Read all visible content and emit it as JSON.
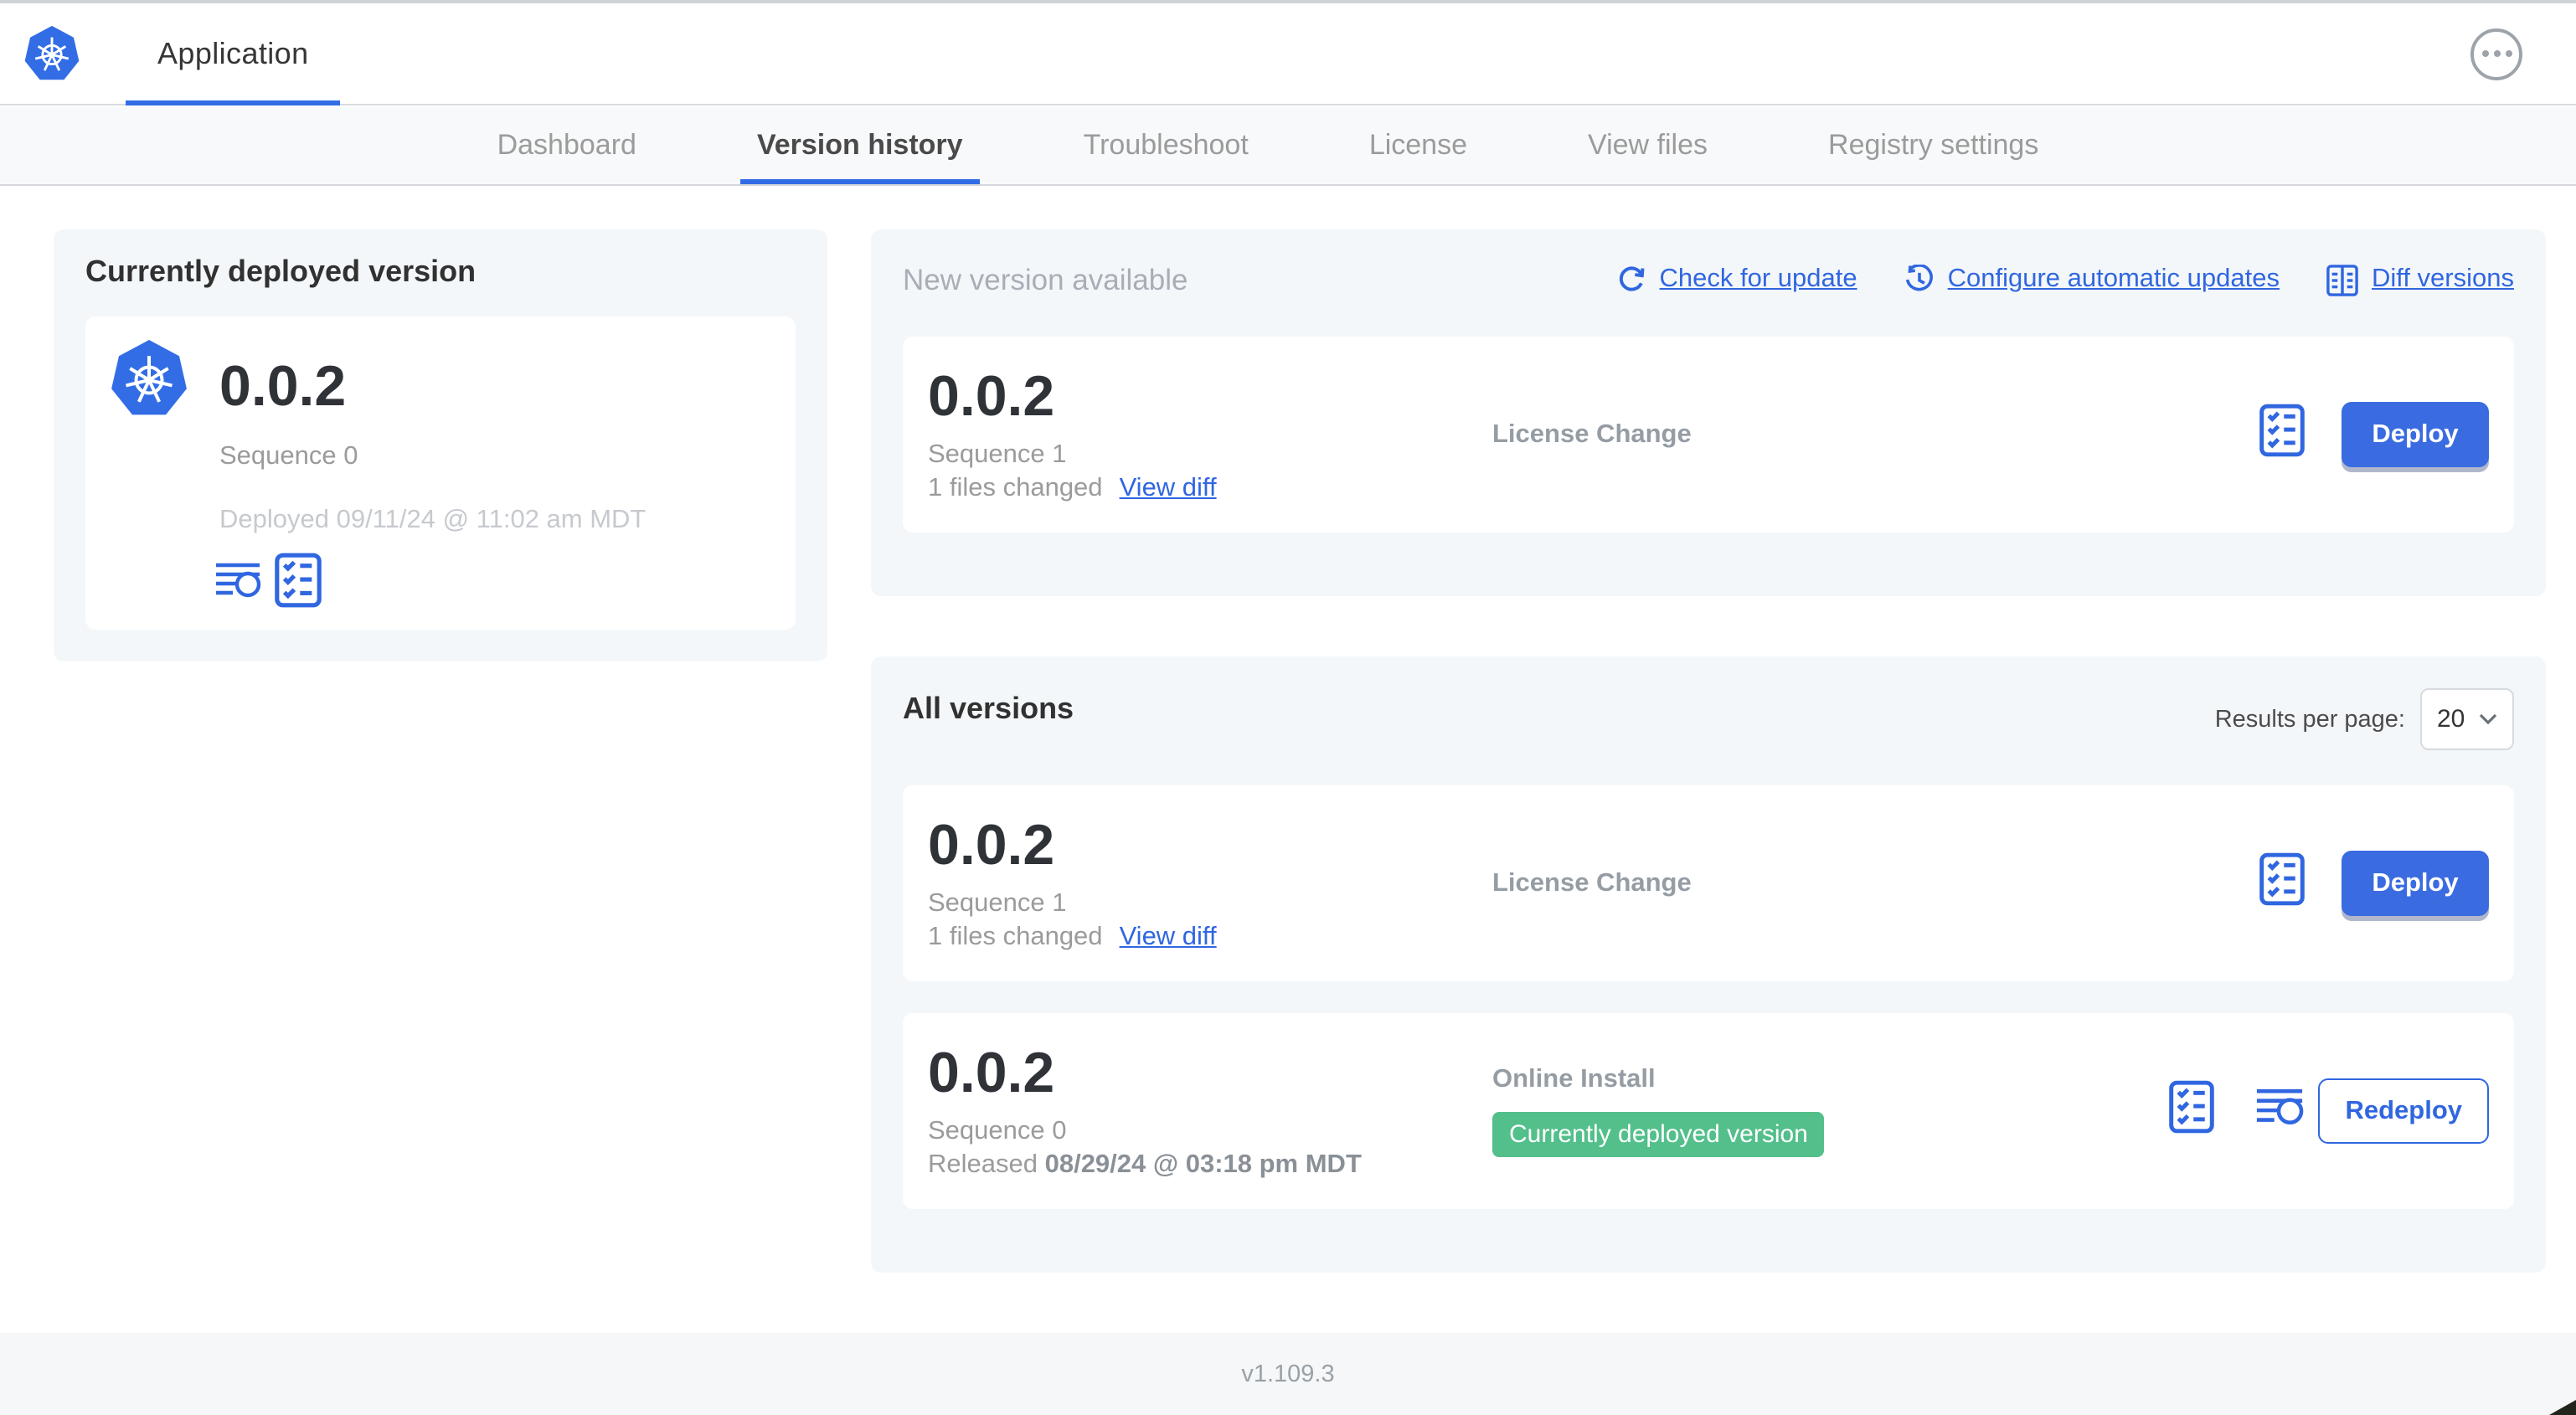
{
  "header": {
    "app_title": "Application"
  },
  "nav": {
    "tabs": [
      {
        "label": "Dashboard",
        "active": false
      },
      {
        "label": "Version history",
        "active": true
      },
      {
        "label": "Troubleshoot",
        "active": false
      },
      {
        "label": "License",
        "active": false
      },
      {
        "label": "View files",
        "active": false
      },
      {
        "label": "Registry settings",
        "active": false
      }
    ]
  },
  "current_version": {
    "title": "Currently deployed version",
    "version": "0.0.2",
    "sequence": "Sequence 0",
    "deployed": "Deployed 09/11/24 @ 11:02 am MDT"
  },
  "new_version": {
    "title": "New version available",
    "links": {
      "check_for_update": "Check for update",
      "configure_updates": "Configure automatic updates",
      "diff_versions": "Diff versions"
    },
    "row": {
      "version": "0.0.2",
      "sequence": "Sequence 1",
      "files_changed": "1 files changed",
      "view_diff": "View diff",
      "type": "License Change",
      "deploy": "Deploy"
    }
  },
  "all_versions": {
    "title": "All versions",
    "results_per_page_label": "Results per page:",
    "results_per_page_value": "20",
    "rows": [
      {
        "version": "0.0.2",
        "sequence": "Sequence 1",
        "files_changed": "1 files changed",
        "view_diff": "View diff",
        "type": "License Change",
        "deploy": "Deploy"
      },
      {
        "version": "0.0.2",
        "sequence": "Sequence 0",
        "released_prefix": "Released ",
        "released_date": "08/29/24 @ 03:18 pm MDT",
        "type": "Online Install",
        "badge": "Currently deployed version",
        "redeploy": "Redeploy"
      }
    ]
  },
  "footer": {
    "version": "v1.109.3"
  },
  "colors": {
    "accent_blue": "#3066e0",
    "kubernetes_blue": "#326de6",
    "badge_green": "#53bf8b"
  }
}
